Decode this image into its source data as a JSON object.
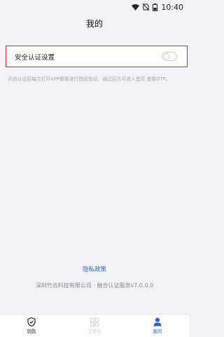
{
  "status_bar": {
    "time": "10:40"
  },
  "header": {
    "title": "我的"
  },
  "settings": {
    "security_label": "安全认证设置",
    "security_enabled": false,
    "hint": "开启认证后每次打开APP都需进行指纹验证，通过后方可进入首页 查看OTP。"
  },
  "footer": {
    "privacy_label": "隐私政策",
    "copyright": "深圳竹云科技有限公司 · 融合认证服务v7.0.0.0"
  },
  "nav": {
    "items": [
      {
        "label": "钥匙",
        "icon": "shield-icon"
      },
      {
        "label": "工作台",
        "icon": "grid-icon"
      },
      {
        "label": "我的",
        "icon": "person-icon"
      }
    ],
    "active": "我的"
  },
  "colors": {
    "accent": "#2f63d6",
    "highlight_border": "#e0241f"
  }
}
